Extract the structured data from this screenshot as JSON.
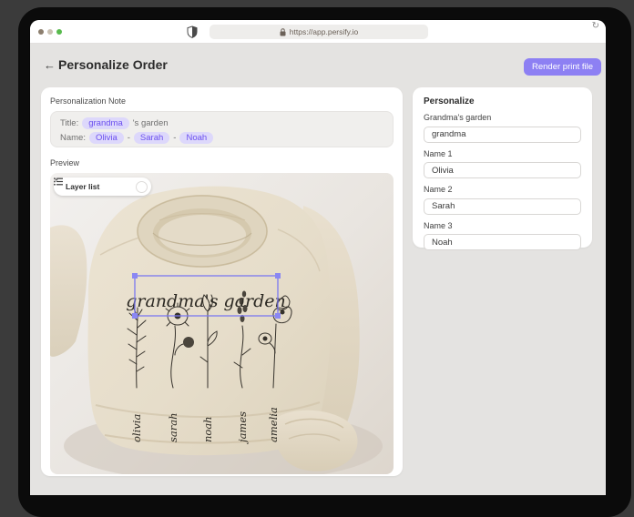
{
  "browser": {
    "url": "https://app.persify.io",
    "refresh_icon": "↻",
    "traffic_light_colors": [
      "#8c7e6e",
      "#cac1b3",
      "#58ba4d"
    ]
  },
  "header": {
    "back_arrow": "←",
    "title": "Personalize Order",
    "render_button_label": "Render print file"
  },
  "note": {
    "section_label": "Personalization Note",
    "title_label": "Title:",
    "title_chip": "grandma",
    "title_suffix": "'s garden",
    "name_label": "Name:",
    "name_chips": [
      "Olivia",
      "Sarah",
      "Noah"
    ],
    "separator": "-"
  },
  "preview": {
    "section_label": "Preview",
    "layer_list_label": "Layer list",
    "design_title": "grandma's garden",
    "flower_names": [
      "olivia",
      "sarah",
      "noah",
      "james",
      "amelia"
    ]
  },
  "personalize_panel": {
    "title": "Personalize",
    "fields": [
      {
        "label": "Grandma's garden",
        "value": "grandma"
      },
      {
        "label": "Name 1",
        "value": "Olivia"
      },
      {
        "label": "Name 2",
        "value": "Sarah"
      },
      {
        "label": "Name 3",
        "value": "Noah"
      }
    ]
  },
  "colors": {
    "accent": "#8d80f3",
    "chip_bg": "#ddd8fb",
    "chip_text": "#6c50ef",
    "selection_box": "#7b78f0",
    "page_bg": "#e4e3e1",
    "canvas_bg": "#3b3b3b"
  }
}
